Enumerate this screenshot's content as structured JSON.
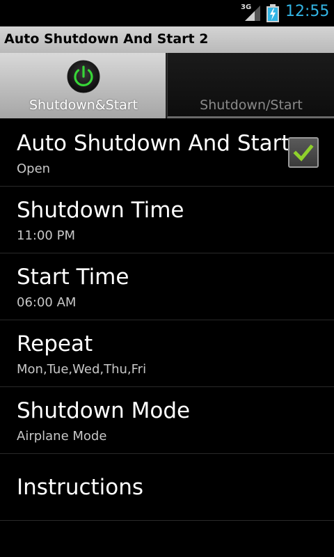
{
  "status": {
    "network": "3G",
    "time": "12:55"
  },
  "app": {
    "title": "Auto Shutdown And Start 2"
  },
  "tabs": [
    {
      "label": "Shutdown&Start",
      "active": true,
      "icon": "power-icon"
    },
    {
      "label": "Shutdown/Start",
      "active": false
    }
  ],
  "settings": [
    {
      "title": "Auto Shutdown And Start",
      "summary": "Open",
      "checked": true
    },
    {
      "title": "Shutdown Time",
      "summary": "11:00 PM"
    },
    {
      "title": "Start Time",
      "summary": "06:00 AM"
    },
    {
      "title": "Repeat",
      "summary": "Mon,Tue,Wed,Thu,Fri"
    },
    {
      "title": "Shutdown Mode",
      "summary": "Airplane Mode"
    },
    {
      "title": "Instructions"
    }
  ],
  "colors": {
    "accent_blue": "#33b5e5",
    "power_green": "#37d637",
    "check_green": "#8fd12c"
  }
}
